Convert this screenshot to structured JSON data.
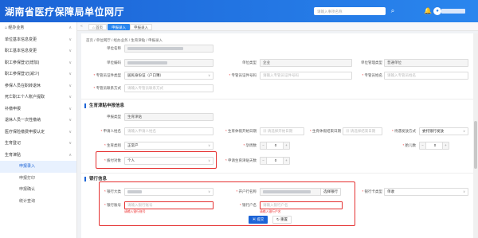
{
  "app": {
    "title": "湖南省医疗保障局单位网厅",
    "search_placeholder": "请输入事项名称"
  },
  "tabs": [
    "首页",
    "申报录入",
    "申报录入"
  ],
  "sidebar": [
    {
      "label": "经办业务",
      "icon": "home-icon",
      "chev": "∧"
    },
    {
      "label": "单位基本信息变更",
      "chev": "∨"
    },
    {
      "label": "职工基本信息变更",
      "chev": "∨"
    },
    {
      "label": "职工参保登记(增加)",
      "chev": "∨"
    },
    {
      "label": "职工参保登记(减少)",
      "chev": "∨"
    },
    {
      "label": "参保人员在职转退休",
      "chev": "∨"
    },
    {
      "label": "死亡职工个人账户提取",
      "chev": "∨"
    },
    {
      "label": "补缴申报",
      "chev": "∨"
    },
    {
      "label": "退休人员一次性缴纳",
      "chev": "∨"
    },
    {
      "label": "医疗保险缴费申报认定",
      "chev": "∨"
    },
    {
      "label": "生育登记",
      "chev": "∨"
    },
    {
      "label": "生育津贴",
      "chev": "∧"
    },
    {
      "label": "申报录入",
      "sub": true,
      "active": true
    },
    {
      "label": "申报打印",
      "sub": true
    },
    {
      "label": "申报确认",
      "sub": true
    },
    {
      "label": "统计查询",
      "sub": true
    }
  ],
  "breadcrumb": "首页 / 单位网厅 / 经办业务 / 生育津贴 / 申报录入",
  "form": {
    "unit_name_label": "单位名称",
    "unit_no_label": "单位编码",
    "unit_type_label": "单位类型",
    "unit_type_value": "企业",
    "unit_mgmt_label": "单位管理类型",
    "unit_mgmt_value": "普通单位",
    "agent_cert_type_label": "专管员证件类型",
    "agent_cert_type_value": "居民身份证（户口簿）",
    "agent_cert_no_label": "专管员证件号码",
    "agent_cert_no_ph": "请输入专管员证件号码",
    "agent_name_label": "专管员姓名",
    "agent_name_ph": "请输入专管员姓名",
    "agent_contact_label": "专管员联系方式",
    "agent_contact_ph": "请输入专管员联系方式"
  },
  "sec1": {
    "title": "生育津贴申报信息",
    "apply_type_label": "申报类型",
    "apply_type_value": "生育津贴",
    "app_name_label": "申请人姓名",
    "app_name_ph": "请输入申请人姓名",
    "start_date_label": "生育休假开始日期",
    "start_date_ph": "请选择开始日期",
    "end_date_label": "生育休假结束日期",
    "end_date_ph": "请选择结束日期",
    "treat_label": "待遇发放方式",
    "treat_value": "委托银行发放",
    "birth_type_label": "生育类别",
    "birth_type_value": "正常产",
    "preg_days_label": "孕周数",
    "preg_days_value": "0",
    "births_label": "胎儿数",
    "births_value": "0",
    "payee_label": "拨付对象",
    "payee_value": "个人",
    "extra_days_label": "申请生育津贴天数",
    "extra_days_value": "0"
  },
  "sec2": {
    "title": "银行信息",
    "bank_label": "银行大类",
    "acct_name_label": "开户行名称",
    "select_bank_label": "选择银行",
    "acct_type_label": "银行卡类型",
    "acct_type_value": "单收",
    "acct_no_label": "银行账号",
    "acct_no_ph": "请输入银行账号",
    "acct_no_err": "请输入银行账号",
    "holder_label": "银行户名",
    "holder_ph": "请输入银行户名",
    "holder_err": "请输入银行户名"
  },
  "actions": {
    "submit": "提交",
    "reset": "重置"
  },
  "colors": {
    "primary": "#1b63d6",
    "error": "#e53030"
  }
}
